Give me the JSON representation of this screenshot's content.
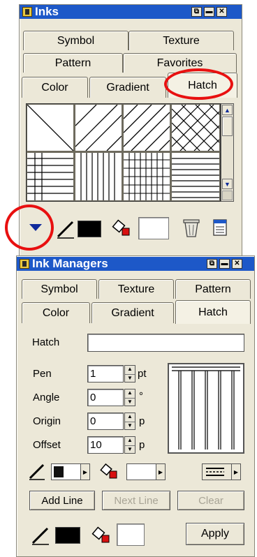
{
  "inks_panel": {
    "title": "Inks",
    "tabs_row1": [
      "Symbol",
      "Texture"
    ],
    "tabs_row2": [
      "Pattern",
      "Favorites"
    ],
    "tabs_row3": [
      "Color",
      "Gradient",
      "Hatch"
    ],
    "active_tab": "Hatch"
  },
  "ink_managers": {
    "title": "Ink Managers",
    "tabs_row1": [
      "Symbol",
      "Texture",
      "Pattern"
    ],
    "tabs_row2": [
      "Color",
      "Gradient",
      "Hatch"
    ],
    "active_tab": "Hatch",
    "hatch_label": "Hatch",
    "hatch_value": "",
    "fields": [
      {
        "label": "Pen",
        "value": "1",
        "unit": "pt"
      },
      {
        "label": "Angle",
        "value": "0",
        "unit": "°"
      },
      {
        "label": "Origin",
        "value": "0",
        "unit": "p"
      },
      {
        "label": "Offset",
        "value": "10",
        "unit": "p"
      }
    ],
    "buttons": {
      "add_line": "Add Line",
      "next_line": "Next Line",
      "clear": "Clear",
      "apply": "Apply"
    }
  },
  "colors": {
    "title_bar": "#1d58c8",
    "panel": "#ece8d8",
    "highlight_ring": "#e81010"
  }
}
